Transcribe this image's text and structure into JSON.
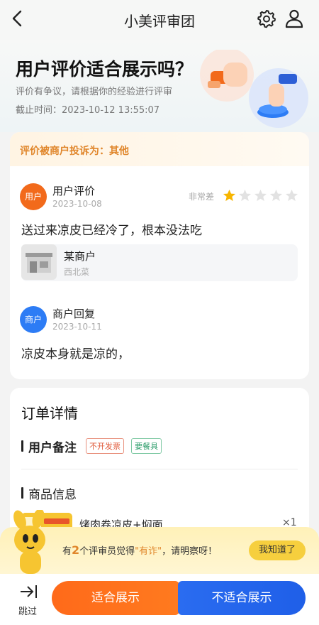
{
  "nav": {
    "title": "小美评审团"
  },
  "header": {
    "title": "用户评价适合展示吗？",
    "subtitle": "评价有争议，请根据你的经验进行评审",
    "deadline": "截止时间：2023-10-12 13:55:07"
  },
  "complaint": {
    "text": "评价被商户投诉为：其他"
  },
  "user_review": {
    "avatar_text": "用户",
    "label": "用户评价",
    "date": "2023-10-08",
    "rating_label": "非常差",
    "rating": 1,
    "rating_max": 5,
    "text": "送过来凉皮已经冷了，根本没法吃"
  },
  "merchant": {
    "name": "某商户",
    "category": "西北菜"
  },
  "merchant_reply": {
    "avatar_text": "商户",
    "label": "商户回复",
    "date": "2023-10-11",
    "text": "凉皮本身就是凉的，"
  },
  "order": {
    "title": "订单详情",
    "remark_label": "用户备注",
    "tags": [
      "不开发票",
      "要餐具"
    ],
    "product_section_label": "商品信息",
    "product_name": "烤肉卷凉皮+焖面",
    "product_qty": "×1"
  },
  "notice": {
    "prefix": "有",
    "count": "2",
    "middle": "个评审员觉得",
    "quote": "\"有诈\"",
    "suffix": "，请明察呀！",
    "button": "我知道了"
  },
  "actions": {
    "skip": "跳过",
    "fit": "适合展示",
    "unfit": "不适合展示"
  },
  "colors": {
    "accent_orange": "#ff6a1a",
    "accent_blue": "#2a6cf0",
    "star_active": "#f7b500",
    "star_inactive": "#e2e2e2"
  }
}
